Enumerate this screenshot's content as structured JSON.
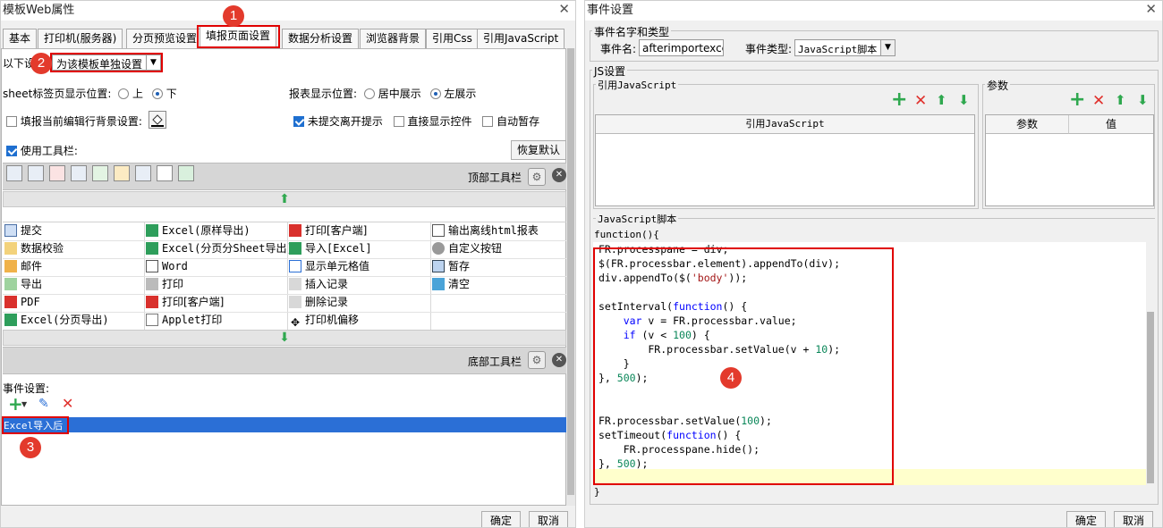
{
  "left": {
    "title": "模板Web属性",
    "tabs": [
      "基本",
      "打印机(服务器)",
      "分页预览设置",
      "填报页面设置",
      "数据分析设置",
      "浏览器背景",
      "引用Css",
      "引用JavaScript"
    ],
    "scope_label": "以下设",
    "scope_value": "为该模板单独设置",
    "sheet_pos_label": "sheet标签页显示位置:",
    "sheet_pos_options": [
      "上",
      "下"
    ],
    "report_pos_label": "报表显示位置:",
    "report_pos_options": [
      "居中展示",
      "左展示"
    ],
    "fill_bg_label": "填报当前编辑行背景设置:",
    "unsubmitted_label": "未提交离开提示",
    "direct_show_label": "直接显示控件",
    "autosave_label": "自动暂存",
    "use_toolbar_label": "使用工具栏:",
    "restore_default": "恢复默认",
    "top_toolbar": "顶部工具栏",
    "bottom_toolbar": "底部工具栏",
    "buttons": [
      [
        "提交",
        "Excel(原样导出)",
        "打印[客户端]",
        "输出离线html报表"
      ],
      [
        "数据校验",
        "Excel(分页分Sheet导出)",
        "导入[Excel]",
        "自定义按钮"
      ],
      [
        "邮件",
        "Word",
        "显示单元格值",
        "暂存"
      ],
      [
        "导出",
        "打印",
        "插入记录",
        "清空"
      ],
      [
        "PDF",
        "打印[客户端]",
        "删除记录",
        ""
      ],
      [
        "Excel(分页导出)",
        "Applet打印",
        "打印机偏移",
        ""
      ]
    ],
    "events_label": "事件设置:",
    "event_item": "Excel导入后",
    "ok": "确定",
    "cancel": "取消"
  },
  "right": {
    "title": "事件设置",
    "section_name_type": "事件名字和类型",
    "event_name_label": "事件名:",
    "event_name_value": "afterimportexcel",
    "event_type_label": "事件类型:",
    "event_type_value": "JavaScript脚本",
    "js_settings": "JS设置",
    "ref_js": "引用JavaScript",
    "params": "参数",
    "ref_js_col": "引用JavaScript",
    "param_col": "参数",
    "value_col": "值",
    "js_script": "JavaScript脚本",
    "func_open": "function(){",
    "func_close": "}",
    "ok": "确定",
    "cancel": "取消"
  },
  "badges": [
    "1",
    "2",
    "3",
    "4"
  ],
  "colors": {
    "accent_red": "#e00000",
    "badge": "#e33a2c",
    "selection": "#2b6fd6",
    "add_green": "#2fa84f",
    "delete_red": "#e0302c"
  }
}
